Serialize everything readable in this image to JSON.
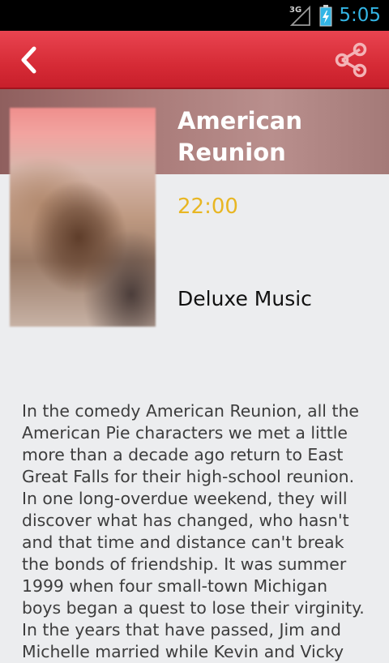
{
  "status_bar": {
    "network": "3G",
    "time": "5:05"
  },
  "action_bar": {
    "back_icon": "chevron-left-icon",
    "share_icon": "share-icon",
    "color": "#d62b36"
  },
  "program": {
    "title": "American Reunion",
    "time": "22:00",
    "channel": "Deluxe Music",
    "description": "In the comedy American Reunion, all the American Pie characters we met a little more than a decade ago return to East Great Falls for their high-school reunion. In one long-overdue weekend, they will discover what has changed, who hasn't and that time and distance can't break the bonds of friendship. It was summer 1999 when four small-town Michigan boys began a quest to lose their virginity.  In the years that have passed, Jim and Michelle married while Kevin and Vicky"
  },
  "colors": {
    "accent_time": "#e8b623",
    "status_time": "#33b5e5"
  }
}
